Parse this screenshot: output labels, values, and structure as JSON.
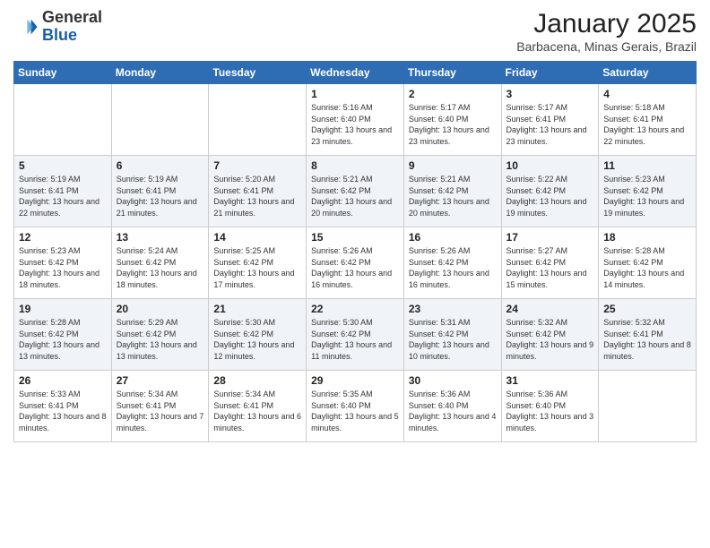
{
  "header": {
    "logo_general": "General",
    "logo_blue": "Blue",
    "title": "January 2025",
    "subtitle": "Barbacena, Minas Gerais, Brazil"
  },
  "days_of_week": [
    "Sunday",
    "Monday",
    "Tuesday",
    "Wednesday",
    "Thursday",
    "Friday",
    "Saturday"
  ],
  "weeks": [
    [
      {
        "day": "",
        "info": ""
      },
      {
        "day": "",
        "info": ""
      },
      {
        "day": "",
        "info": ""
      },
      {
        "day": "1",
        "info": "Sunrise: 5:16 AM\nSunset: 6:40 PM\nDaylight: 13 hours\nand 23 minutes."
      },
      {
        "day": "2",
        "info": "Sunrise: 5:17 AM\nSunset: 6:40 PM\nDaylight: 13 hours\nand 23 minutes."
      },
      {
        "day": "3",
        "info": "Sunrise: 5:17 AM\nSunset: 6:41 PM\nDaylight: 13 hours\nand 23 minutes."
      },
      {
        "day": "4",
        "info": "Sunrise: 5:18 AM\nSunset: 6:41 PM\nDaylight: 13 hours\nand 22 minutes."
      }
    ],
    [
      {
        "day": "5",
        "info": "Sunrise: 5:19 AM\nSunset: 6:41 PM\nDaylight: 13 hours\nand 22 minutes."
      },
      {
        "day": "6",
        "info": "Sunrise: 5:19 AM\nSunset: 6:41 PM\nDaylight: 13 hours\nand 21 minutes."
      },
      {
        "day": "7",
        "info": "Sunrise: 5:20 AM\nSunset: 6:41 PM\nDaylight: 13 hours\nand 21 minutes."
      },
      {
        "day": "8",
        "info": "Sunrise: 5:21 AM\nSunset: 6:42 PM\nDaylight: 13 hours\nand 20 minutes."
      },
      {
        "day": "9",
        "info": "Sunrise: 5:21 AM\nSunset: 6:42 PM\nDaylight: 13 hours\nand 20 minutes."
      },
      {
        "day": "10",
        "info": "Sunrise: 5:22 AM\nSunset: 6:42 PM\nDaylight: 13 hours\nand 19 minutes."
      },
      {
        "day": "11",
        "info": "Sunrise: 5:23 AM\nSunset: 6:42 PM\nDaylight: 13 hours\nand 19 minutes."
      }
    ],
    [
      {
        "day": "12",
        "info": "Sunrise: 5:23 AM\nSunset: 6:42 PM\nDaylight: 13 hours\nand 18 minutes."
      },
      {
        "day": "13",
        "info": "Sunrise: 5:24 AM\nSunset: 6:42 PM\nDaylight: 13 hours\nand 18 minutes."
      },
      {
        "day": "14",
        "info": "Sunrise: 5:25 AM\nSunset: 6:42 PM\nDaylight: 13 hours\nand 17 minutes."
      },
      {
        "day": "15",
        "info": "Sunrise: 5:26 AM\nSunset: 6:42 PM\nDaylight: 13 hours\nand 16 minutes."
      },
      {
        "day": "16",
        "info": "Sunrise: 5:26 AM\nSunset: 6:42 PM\nDaylight: 13 hours\nand 16 minutes."
      },
      {
        "day": "17",
        "info": "Sunrise: 5:27 AM\nSunset: 6:42 PM\nDaylight: 13 hours\nand 15 minutes."
      },
      {
        "day": "18",
        "info": "Sunrise: 5:28 AM\nSunset: 6:42 PM\nDaylight: 13 hours\nand 14 minutes."
      }
    ],
    [
      {
        "day": "19",
        "info": "Sunrise: 5:28 AM\nSunset: 6:42 PM\nDaylight: 13 hours\nand 13 minutes."
      },
      {
        "day": "20",
        "info": "Sunrise: 5:29 AM\nSunset: 6:42 PM\nDaylight: 13 hours\nand 13 minutes."
      },
      {
        "day": "21",
        "info": "Sunrise: 5:30 AM\nSunset: 6:42 PM\nDaylight: 13 hours\nand 12 minutes."
      },
      {
        "day": "22",
        "info": "Sunrise: 5:30 AM\nSunset: 6:42 PM\nDaylight: 13 hours\nand 11 minutes."
      },
      {
        "day": "23",
        "info": "Sunrise: 5:31 AM\nSunset: 6:42 PM\nDaylight: 13 hours\nand 10 minutes."
      },
      {
        "day": "24",
        "info": "Sunrise: 5:32 AM\nSunset: 6:42 PM\nDaylight: 13 hours\nand 9 minutes."
      },
      {
        "day": "25",
        "info": "Sunrise: 5:32 AM\nSunset: 6:41 PM\nDaylight: 13 hours\nand 8 minutes."
      }
    ],
    [
      {
        "day": "26",
        "info": "Sunrise: 5:33 AM\nSunset: 6:41 PM\nDaylight: 13 hours\nand 8 minutes."
      },
      {
        "day": "27",
        "info": "Sunrise: 5:34 AM\nSunset: 6:41 PM\nDaylight: 13 hours\nand 7 minutes."
      },
      {
        "day": "28",
        "info": "Sunrise: 5:34 AM\nSunset: 6:41 PM\nDaylight: 13 hours\nand 6 minutes."
      },
      {
        "day": "29",
        "info": "Sunrise: 5:35 AM\nSunset: 6:40 PM\nDaylight: 13 hours\nand 5 minutes."
      },
      {
        "day": "30",
        "info": "Sunrise: 5:36 AM\nSunset: 6:40 PM\nDaylight: 13 hours\nand 4 minutes."
      },
      {
        "day": "31",
        "info": "Sunrise: 5:36 AM\nSunset: 6:40 PM\nDaylight: 13 hours\nand 3 minutes."
      },
      {
        "day": "",
        "info": ""
      }
    ]
  ]
}
